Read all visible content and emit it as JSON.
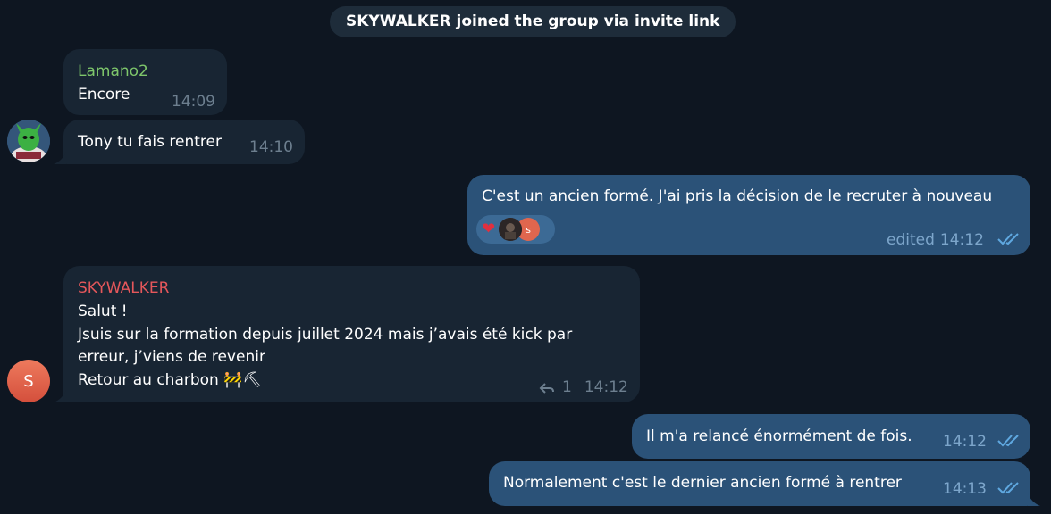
{
  "service_message": "SKYWALKER joined the group via invite link",
  "colors": {
    "background": "#0e1621",
    "incoming_bubble": "#182533",
    "outgoing_bubble": "#2b5278",
    "lamano_name": "#7ec66b",
    "skywalker_name": "#e5575b",
    "check_color": "#5fa8e0"
  },
  "messages": [
    {
      "sender": "Lamano2",
      "text": "Encore",
      "time": "14:09"
    },
    {
      "text": "Tony tu fais rentrer",
      "time": "14:10"
    },
    {
      "text": "C'est un ancien formé. J'ai pris la décision de le recruter à nouveau",
      "edited_label": "edited",
      "time": "14:12",
      "reactions": {
        "emoji": "heart",
        "avatar_letter": "s"
      }
    },
    {
      "sender": "SKYWALKER",
      "lines": [
        "Salut !",
        "Jsuis sur la formation depuis juillet 2024 mais j’avais été kick par",
        "erreur, j’viens de revenir",
        "Retour au charbon 🚧⛏"
      ],
      "reply_count": "1",
      "time": "14:12",
      "avatar_letter": "S"
    },
    {
      "text": "Il m'a relancé énormément de fois.",
      "time": "14:12"
    },
    {
      "text": "Normalement c'est le dernier ancien formé à rentrer",
      "time": "14:13"
    }
  ]
}
